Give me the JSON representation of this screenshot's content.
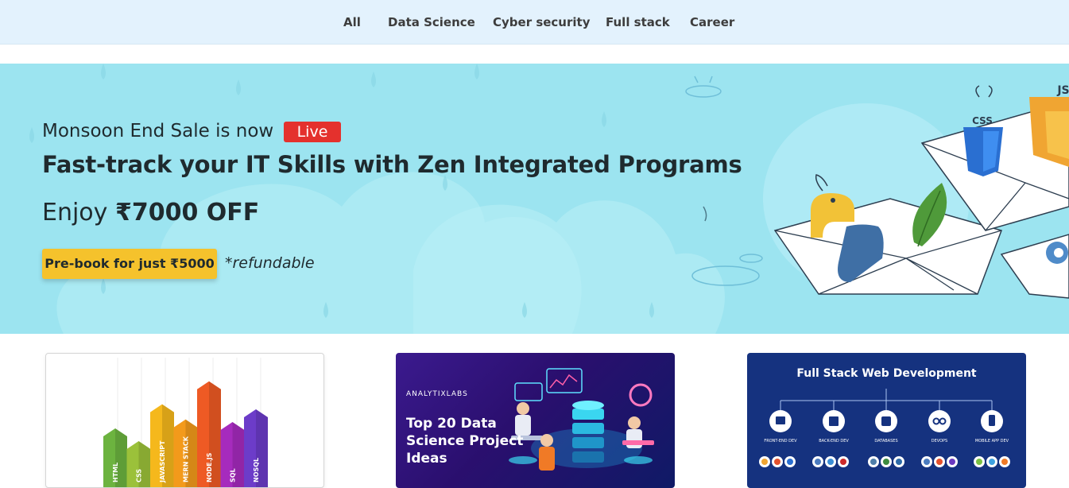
{
  "nav": {
    "tabs": [
      {
        "label": "All"
      },
      {
        "label": "Data Science"
      },
      {
        "label": "Cyber security"
      },
      {
        "label": "Full stack"
      },
      {
        "label": "Career"
      }
    ]
  },
  "banner": {
    "sale_text": "Monsoon End Sale is now",
    "live_badge": "Live",
    "headline": "Fast-track your IT Skills with Zen Integrated Programs",
    "offer_prefix": "Enjoy",
    "offer_amount": "₹7000 OFF",
    "cta_label": "Pre-book for just ₹5000",
    "refund_note": "*refundable",
    "logo_css": "CSS",
    "logo_js": "JS",
    "colors": {
      "background": "#9ce4f0",
      "live": "#e4312d",
      "cta": "#f5c22c"
    }
  },
  "cards": {
    "card1": {
      "bars": [
        {
          "label": "HTML",
          "color": "#6cb33f",
          "level": 0.45
        },
        {
          "label": "CSS",
          "color": "#9bc13a",
          "level": 0.35
        },
        {
          "label": "JAVASCRIPT",
          "color": "#f5b81c",
          "level": 0.64
        },
        {
          "label": "MERN STACK",
          "color": "#f39a1b",
          "level": 0.52
        },
        {
          "label": "NODE.JS",
          "color": "#ee5a24",
          "level": 0.82
        },
        {
          "label": "SQL",
          "color": "#a62bbd",
          "level": 0.5
        },
        {
          "label": "NOSQL",
          "color": "#6c3cc9",
          "level": 0.6
        }
      ]
    },
    "card2": {
      "brand": "ANALYTIXLABS",
      "title": "Top 20 Data Science Project Ideas"
    },
    "card3": {
      "title": "Full Stack Web Development",
      "nodes": [
        {
          "label": "FRONT-END DEV"
        },
        {
          "label": "BACK-END DEV"
        },
        {
          "label": "DATABASES"
        },
        {
          "label": "DEVOPS"
        },
        {
          "label": "MOBILE APP DEV"
        }
      ]
    }
  }
}
